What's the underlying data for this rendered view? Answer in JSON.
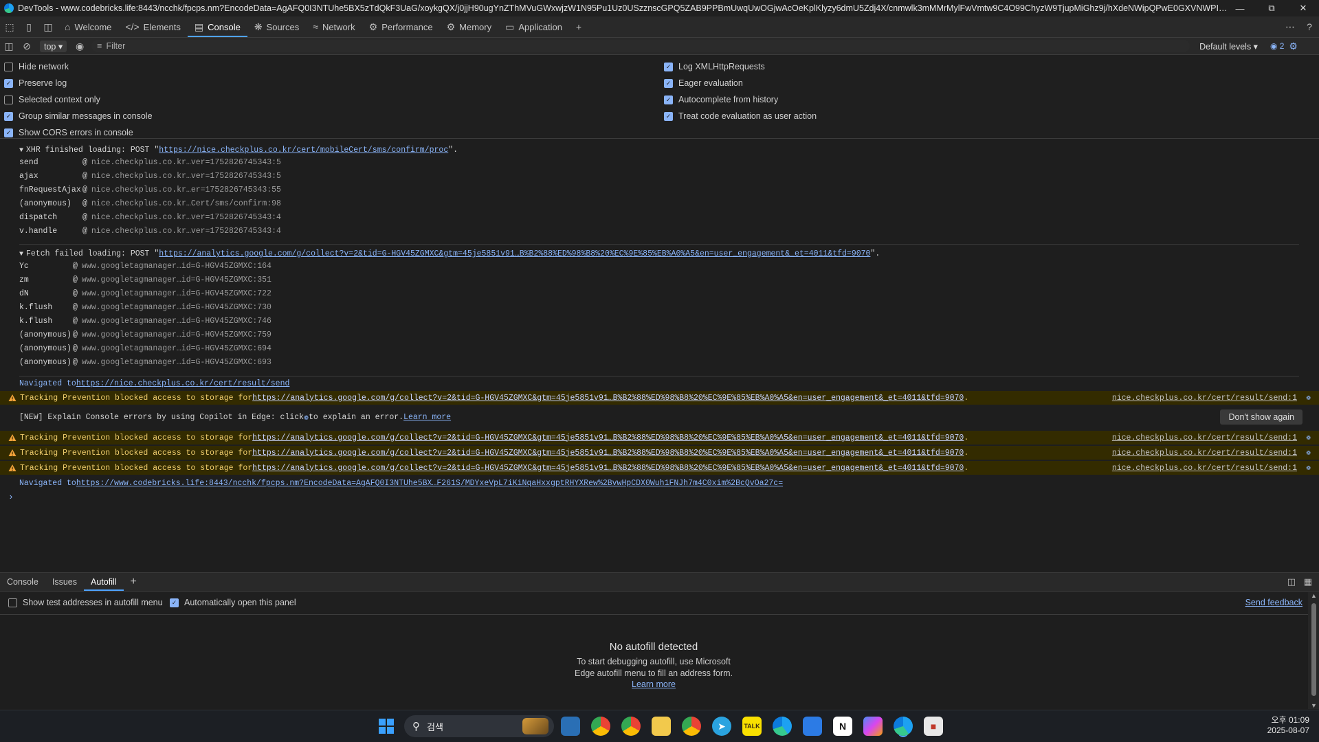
{
  "window": {
    "title": "DevTools - www.codebricks.life:8443/ncchk/fpcps.nm?EncodeData=AgAFQ0I3NTUhe5BX5zTdQkF3UaG/xoykgQX/j0jjH90ugYnZThMVuGWxwjzW1N95Pu1Uz0USzznscGPQ5ZAB9PPBmUwqUwOGjwAcOeKplKlyzy6dmU5Zdj4X/cnmwlk3mMMrMylFwVmtw9C4O99ChyzW9TjupMiGhz9j/hXdeNWipQPwE0GXVNWPIF0YNuSzl2CUZjM/U..."
  },
  "devtools_tabs": [
    "Welcome",
    "Elements",
    "Console",
    "Sources",
    "Network",
    "Performance",
    "Memory",
    "Application"
  ],
  "toolbar": {
    "context": "top",
    "filter_placeholder": "Filter",
    "levels": "Default levels",
    "issues_count": "2"
  },
  "settings_left": [
    {
      "label": "Hide network",
      "checked": false
    },
    {
      "label": "Preserve log",
      "checked": true
    },
    {
      "label": "Selected context only",
      "checked": false
    },
    {
      "label": "Group similar messages in console",
      "checked": true
    },
    {
      "label": "Show CORS errors in console",
      "checked": true
    }
  ],
  "settings_right": [
    {
      "label": "Log XMLHttpRequests",
      "checked": true
    },
    {
      "label": "Eager evaluation",
      "checked": true
    },
    {
      "label": "Autocomplete from history",
      "checked": true
    },
    {
      "label": "Treat code evaluation as user action",
      "checked": true
    }
  ],
  "xhr_group": {
    "prefix": "XHR finished loading: POST \"",
    "url": "https://nice.checkplus.co.kr/cert/mobileCert/sms/confirm/proc",
    "suffix": "\".",
    "frames": [
      {
        "fn": "send",
        "loc": "nice.checkplus.co.kr…ver=1752826745343:5"
      },
      {
        "fn": "ajax",
        "loc": "nice.checkplus.co.kr…ver=1752826745343:5"
      },
      {
        "fn": "fnRequestAjax",
        "loc": "nice.checkplus.co.kr…er=1752826745343:55"
      },
      {
        "fn": "(anonymous)",
        "loc": "nice.checkplus.co.kr…Cert/sms/confirm:98"
      },
      {
        "fn": "dispatch",
        "loc": "nice.checkplus.co.kr…ver=1752826745343:4"
      },
      {
        "fn": "v.handle",
        "loc": "nice.checkplus.co.kr…ver=1752826745343:4"
      }
    ]
  },
  "fetch_group": {
    "prefix": "Fetch failed loading: POST \"",
    "url": "https://analytics.google.com/g/collect?v=2&tid=G-HGV45ZGMXC&gtm=45je5851v91…B%B2%88%ED%98%B8%20%EC%9E%85%EB%A0%A5&en=user_engagement&_et=4011&tfd=9070",
    "suffix": "\".",
    "frames": [
      {
        "fn": "Yc",
        "loc": "www.googletagmanager…id=G-HGV45ZGMXC:164"
      },
      {
        "fn": "zm",
        "loc": "www.googletagmanager…id=G-HGV45ZGMXC:351"
      },
      {
        "fn": "dN",
        "loc": "www.googletagmanager…id=G-HGV45ZGMXC:722"
      },
      {
        "fn": "k.flush",
        "loc": "www.googletagmanager…id=G-HGV45ZGMXC:730"
      },
      {
        "fn": "k.flush",
        "loc": "www.googletagmanager…id=G-HGV45ZGMXC:746"
      },
      {
        "fn": "(anonymous)",
        "loc": "www.googletagmanager…id=G-HGV45ZGMXC:759"
      },
      {
        "fn": "(anonymous)",
        "loc": "www.googletagmanager…id=G-HGV45ZGMXC:694"
      },
      {
        "fn": "(anonymous)",
        "loc": "www.googletagmanager…id=G-HGV45ZGMXC:693"
      }
    ]
  },
  "nav1": {
    "prefix": "Navigated to ",
    "url": "https://nice.checkplus.co.kr/cert/result/send"
  },
  "tracking": {
    "prefix": "Tracking Prevention blocked access to storage for ",
    "url": "https://analytics.google.com/g/collect?v=2&tid=G-HGV45ZGMXC&gtm=45je5851v91…B%B2%88%ED%98%B8%20%EC%9E%85%EB%A0%A5&en=user_engagement&_et=4011&tfd=9070",
    "suffix": ".",
    "source": "nice.checkplus.co.kr/cert/result/send:1"
  },
  "copilot": {
    "text_a": "[NEW] Explain Console errors by using Copilot in Edge: click ",
    "text_b": " to explain an error. ",
    "learn_more": "Learn more",
    "dont_show": "Don't show again"
  },
  "nav2": {
    "prefix": "Navigated to ",
    "url": "https://www.codebricks.life:8443/ncchk/fpcps.nm?EncodeData=AgAFQ0I3NTUhe5BX…F261S/MDYxeVpL7iKiNqaHxxgptRHYXRew%2BvwHpCDX0Wuh1FNJh7m4C0xim%2BcQvOa27c="
  },
  "drawer": {
    "tabs": [
      "Console",
      "Issues",
      "Autofill"
    ],
    "show_test_addresses": "Show test addresses in autofill menu",
    "auto_open": "Automatically open this panel",
    "send_feedback": "Send feedback",
    "empty_title": "No autofill detected",
    "empty_desc": "To start debugging autofill, use Microsoft Edge autofill menu to fill an address form.",
    "learn_more": "Learn more"
  },
  "taskbar": {
    "search_placeholder": "검색",
    "time": "오후 01:09",
    "date": "2025-08-07"
  },
  "colors": {
    "accent": "#4fa3ff",
    "warning_bg": "#332b00",
    "warning_text": "#f2cf6e",
    "link": "#8ab4f8"
  }
}
